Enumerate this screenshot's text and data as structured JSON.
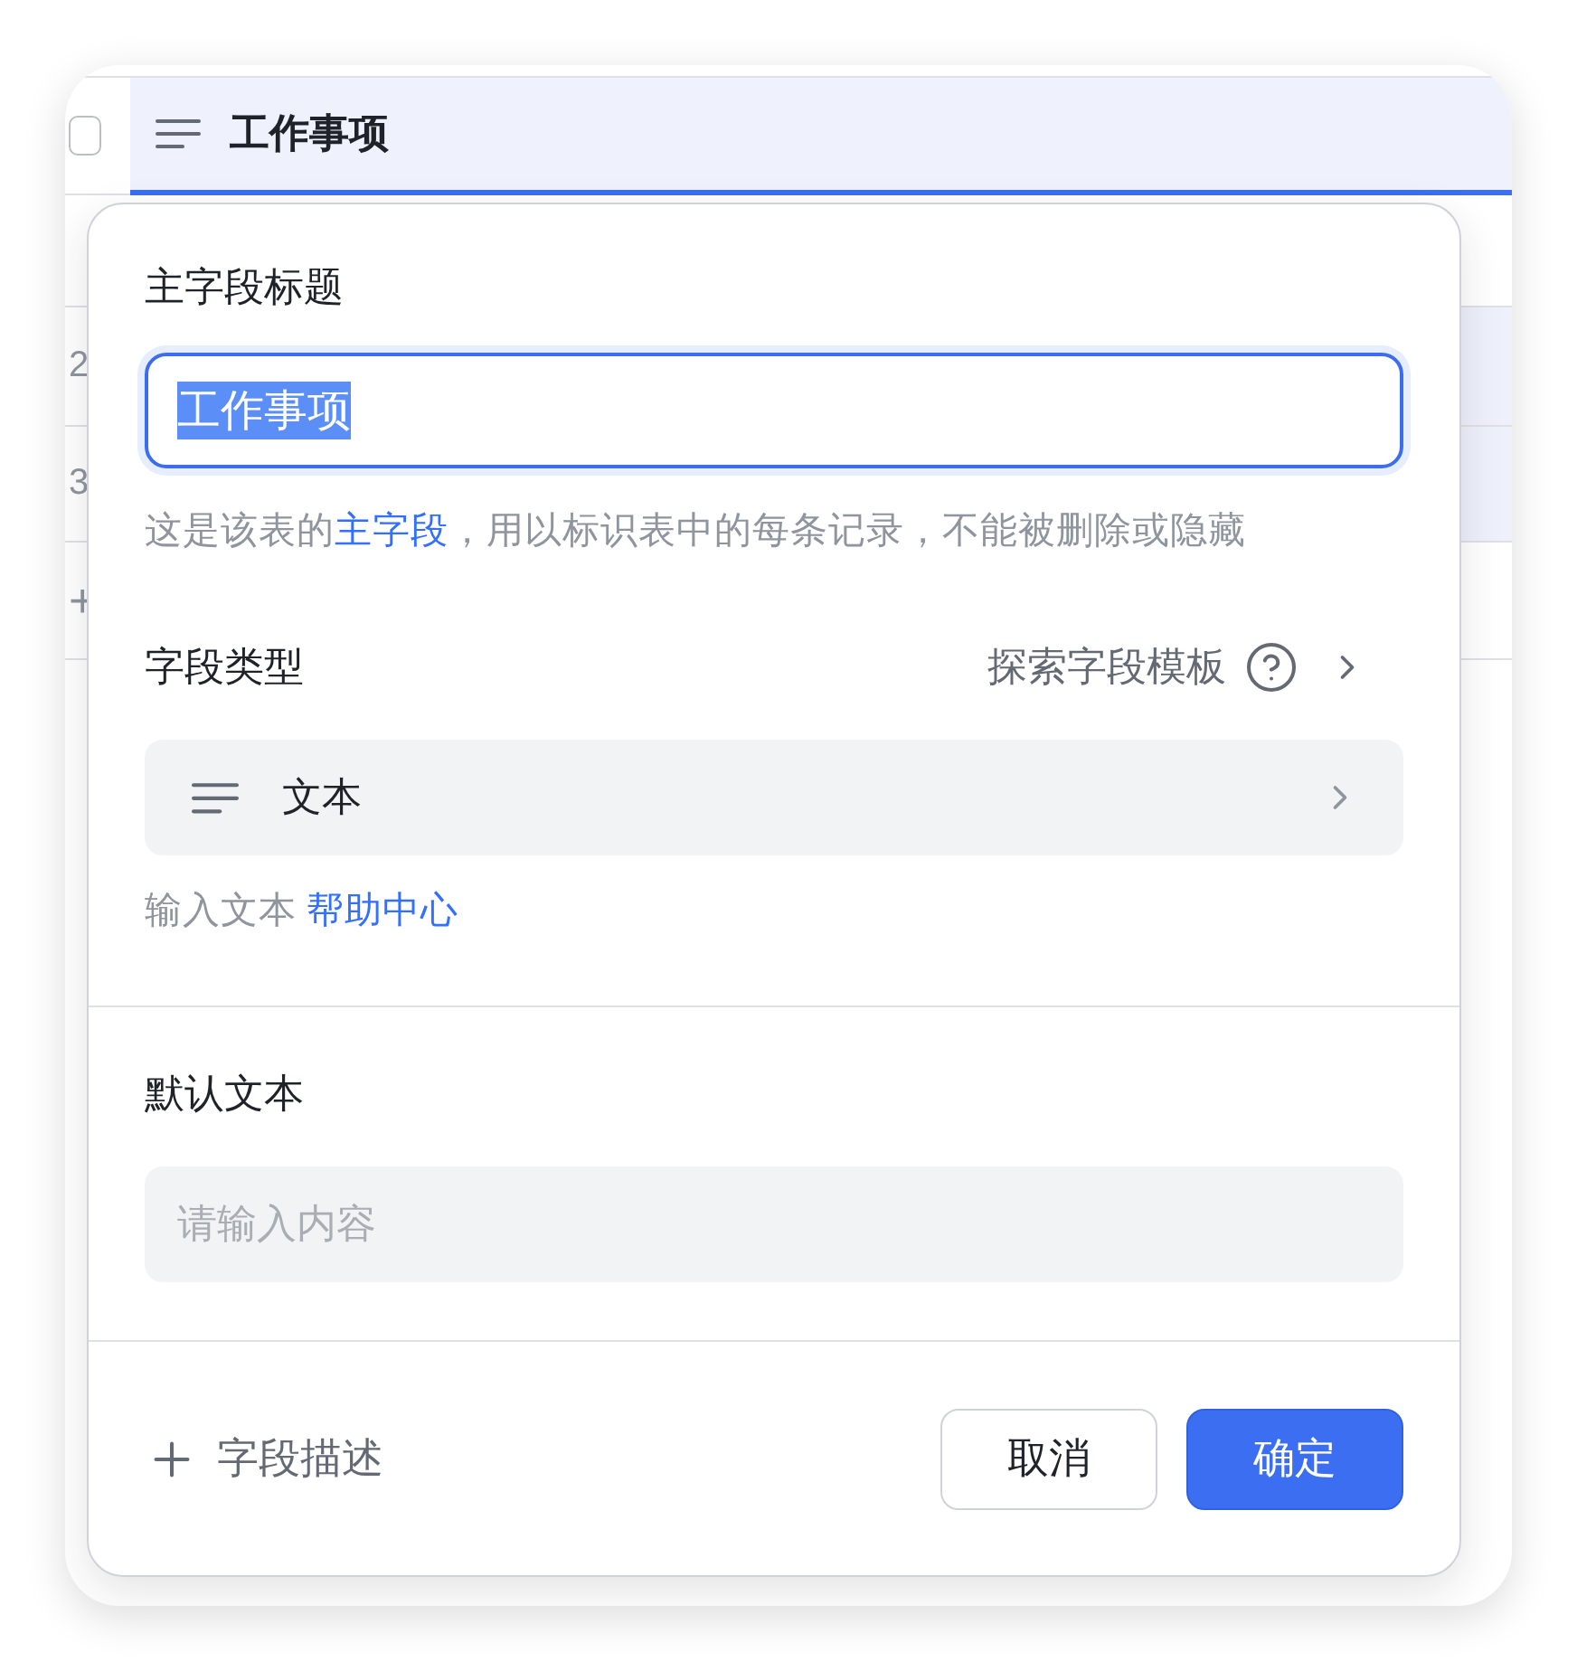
{
  "table": {
    "header": {
      "checked": false,
      "title": "工作事项"
    },
    "rows": [
      {
        "number": "2"
      },
      {
        "number": "3"
      }
    ],
    "add_row": "+"
  },
  "field_dialog": {
    "title_label": "主字段标题",
    "title_input": {
      "value": "工作事项",
      "text_selected": true
    },
    "hint": {
      "before": "这是该表的",
      "link": "主字段",
      "after": "，用以标识表中的每条记录，不能被删除或隐藏"
    },
    "type_label": "字段类型",
    "template_link": "探索字段模板",
    "type_select": {
      "value": "文本"
    },
    "type_hint": "输入文本",
    "help_link": "帮助中心",
    "default_label": "默认文本",
    "default_input": {
      "placeholder": "请输入内容"
    },
    "add_description": "字段描述",
    "buttons": [
      {
        "label": "取消",
        "kind": "secondary"
      },
      {
        "label": "确定",
        "kind": "primary"
      }
    ]
  }
}
